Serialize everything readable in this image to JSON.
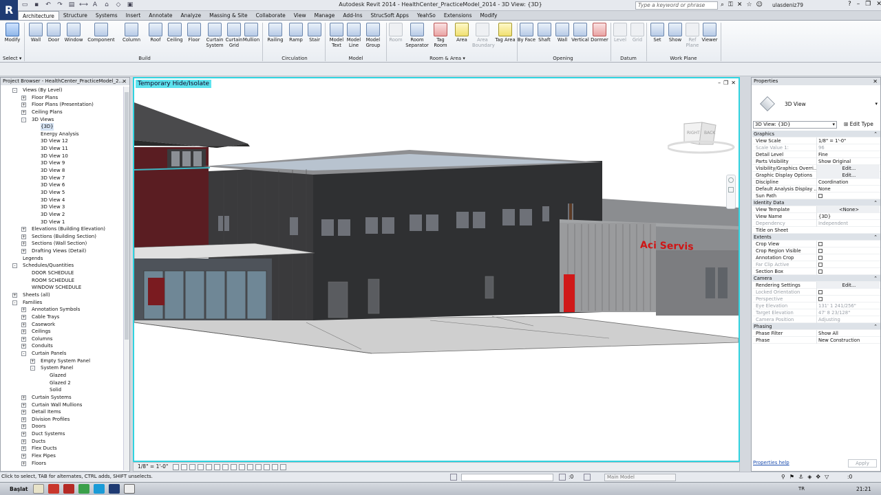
{
  "window": {
    "title": "Autodesk Revit 2014 -   HealthCenter_PracticeModel_2014 - 3D View: {3D}",
    "search_placeholder": "Type a keyword or phrase",
    "user": "ulasdeniz79",
    "app_letter": "R"
  },
  "ribbon": {
    "tabs": [
      "Architecture",
      "Structure",
      "Systems",
      "Insert",
      "Annotate",
      "Analyze",
      "Massing & Site",
      "Collaborate",
      "View",
      "Manage",
      "Add-Ins",
      "StrucSoft Apps",
      "YeahSo",
      "Extensions",
      "Modify"
    ],
    "buttons": {
      "modify": "Modify",
      "wall": "Wall",
      "door": "Door",
      "window": "Window",
      "component": "Component",
      "column": "Column",
      "roof": "Roof",
      "ceiling": "Ceiling",
      "floor": "Floor",
      "curtain_system": "Curtain System",
      "curtain_grid": "Curtain Grid",
      "mullion": "Mullion",
      "railing": "Railing",
      "ramp": "Ramp",
      "stair": "Stair",
      "model_text": "Model Text",
      "model_line": "Model Line",
      "model_group": "Model Group",
      "room": "Room",
      "room_separator": "Room Separator",
      "tag_room": "Tag Room",
      "area": "Area",
      "area_boundary": "Area Boundary",
      "tag_area": "Tag Area",
      "by_face": "By Face",
      "shaft": "Shaft",
      "wall_opening": "Wall",
      "vertical": "Vertical",
      "dormer": "Dormer",
      "level": "Level",
      "grid": "Grid",
      "set": "Set",
      "show": "Show",
      "ref_plane": "Ref Plane",
      "viewer": "Viewer"
    },
    "panels": {
      "build": "Build",
      "circulation": "Circulation",
      "model": "Model",
      "room_area": "Room & Area",
      "opening": "Opening",
      "datum": "Datum",
      "work_plane": "Work Plane"
    },
    "select_label": "Select"
  },
  "project_browser": {
    "title": "Project Browser - HealthCenter_PracticeModel_2...",
    "tree": [
      {
        "label": "Views (By Level)",
        "indent": 0,
        "tog": "-"
      },
      {
        "label": "Floor Plans",
        "indent": 1,
        "tog": "+"
      },
      {
        "label": "Floor Plans (Presentation)",
        "indent": 1,
        "tog": "+"
      },
      {
        "label": "Ceiling Plans",
        "indent": 1,
        "tog": "+"
      },
      {
        "label": "3D Views",
        "indent": 1,
        "tog": "-"
      },
      {
        "label": "{3D}",
        "indent": 2,
        "tog": "",
        "selected": true
      },
      {
        "label": "Energy Analysis",
        "indent": 2,
        "tog": ""
      },
      {
        "label": "3D View 12",
        "indent": 2,
        "tog": ""
      },
      {
        "label": "3D View 11",
        "indent": 2,
        "tog": ""
      },
      {
        "label": "3D View 10",
        "indent": 2,
        "tog": ""
      },
      {
        "label": "3D View 9",
        "indent": 2,
        "tog": ""
      },
      {
        "label": "3D View 8",
        "indent": 2,
        "tog": ""
      },
      {
        "label": "3D View 7",
        "indent": 2,
        "tog": ""
      },
      {
        "label": "3D View 6",
        "indent": 2,
        "tog": ""
      },
      {
        "label": "3D View 5",
        "indent": 2,
        "tog": ""
      },
      {
        "label": "3D View 4",
        "indent": 2,
        "tog": ""
      },
      {
        "label": "3D View 3",
        "indent": 2,
        "tog": ""
      },
      {
        "label": "3D View 2",
        "indent": 2,
        "tog": ""
      },
      {
        "label": "3D View 1",
        "indent": 2,
        "tog": ""
      },
      {
        "label": "Elevations (Building Elevation)",
        "indent": 1,
        "tog": "+"
      },
      {
        "label": "Sections (Building Section)",
        "indent": 1,
        "tog": "+"
      },
      {
        "label": "Sections (Wall Section)",
        "indent": 1,
        "tog": "+"
      },
      {
        "label": "Drafting Views (Detail)",
        "indent": 1,
        "tog": "+"
      },
      {
        "label": "Legends",
        "indent": 0,
        "tog": ""
      },
      {
        "label": "Schedules/Quantities",
        "indent": 0,
        "tog": "-"
      },
      {
        "label": "DOOR SCHEDULE",
        "indent": 1,
        "tog": ""
      },
      {
        "label": "ROOM SCHEDULE",
        "indent": 1,
        "tog": ""
      },
      {
        "label": "WINDOW SCHEDULE",
        "indent": 1,
        "tog": ""
      },
      {
        "label": "Sheets (all)",
        "indent": 0,
        "tog": "+"
      },
      {
        "label": "Families",
        "indent": 0,
        "tog": "-"
      },
      {
        "label": "Annotation Symbols",
        "indent": 1,
        "tog": "+"
      },
      {
        "label": "Cable Trays",
        "indent": 1,
        "tog": "+"
      },
      {
        "label": "Casework",
        "indent": 1,
        "tog": "+"
      },
      {
        "label": "Ceilings",
        "indent": 1,
        "tog": "+"
      },
      {
        "label": "Columns",
        "indent": 1,
        "tog": "+"
      },
      {
        "label": "Conduits",
        "indent": 1,
        "tog": "+"
      },
      {
        "label": "Curtain Panels",
        "indent": 1,
        "tog": "-"
      },
      {
        "label": "Empty System Panel",
        "indent": 2,
        "tog": "+"
      },
      {
        "label": "System Panel",
        "indent": 2,
        "tog": "-"
      },
      {
        "label": "Glazed",
        "indent": 3,
        "tog": ""
      },
      {
        "label": "Glazed 2",
        "indent": 3,
        "tog": ""
      },
      {
        "label": "Solid",
        "indent": 3,
        "tog": ""
      },
      {
        "label": "Curtain Systems",
        "indent": 1,
        "tog": "+"
      },
      {
        "label": "Curtain Wall Mullions",
        "indent": 1,
        "tog": "+"
      },
      {
        "label": "Detail Items",
        "indent": 1,
        "tog": "+"
      },
      {
        "label": "Division Profiles",
        "indent": 1,
        "tog": "+"
      },
      {
        "label": "Doors",
        "indent": 1,
        "tog": "+"
      },
      {
        "label": "Duct Systems",
        "indent": 1,
        "tog": "+"
      },
      {
        "label": "Ducts",
        "indent": 1,
        "tog": "+"
      },
      {
        "label": "Flex Ducts",
        "indent": 1,
        "tog": "+"
      },
      {
        "label": "Flex Pipes",
        "indent": 1,
        "tog": "+"
      },
      {
        "label": "Floors",
        "indent": 1,
        "tog": "+"
      }
    ]
  },
  "viewport": {
    "banner": "Temporary Hide/Isolate",
    "viewcube_right": "RIGHT",
    "viewcube_back": "BACK",
    "sign_text": "Aci Servis",
    "scale": "1/8\" = 1'-0\""
  },
  "properties": {
    "title": "Properties",
    "type_name": "3D View",
    "instance_select": "3D View: {3D}",
    "edit_type": "Edit Type",
    "rows": [
      {
        "group": "Graphics"
      },
      {
        "name": "View Scale",
        "value": "1/8\" = 1'-0\""
      },
      {
        "name": "Scale Value    1:",
        "value": "96",
        "dim": true
      },
      {
        "name": "Detail Level",
        "value": "Fine"
      },
      {
        "name": "Parts Visibility",
        "value": "Show Original"
      },
      {
        "name": "Visibility/Graphics Overri...",
        "value": "Edit...",
        "btn": true
      },
      {
        "name": "Graphic Display Options",
        "value": "Edit...",
        "btn": true
      },
      {
        "name": "Discipline",
        "value": "Coordination"
      },
      {
        "name": "Default Analysis Display ...",
        "value": "None"
      },
      {
        "name": "Sun Path",
        "check": true
      },
      {
        "group": "Identity Data"
      },
      {
        "name": "View Template",
        "value": "<None>",
        "btn": true
      },
      {
        "name": "View Name",
        "value": "{3D}"
      },
      {
        "name": "Dependency",
        "value": "Independent",
        "dim": true
      },
      {
        "name": "Title on Sheet",
        "value": ""
      },
      {
        "group": "Extents"
      },
      {
        "name": "Crop View",
        "check": true
      },
      {
        "name": "Crop Region Visible",
        "check": true
      },
      {
        "name": "Annotation Crop",
        "check": true
      },
      {
        "name": "Far Clip Active",
        "check": true,
        "dim": true
      },
      {
        "name": "Section Box",
        "check": true
      },
      {
        "group": "Camera"
      },
      {
        "name": "Rendering Settings",
        "value": "Edit...",
        "btn": true
      },
      {
        "name": "Locked Orientation",
        "check": true,
        "dim": true
      },
      {
        "name": "Perspective",
        "check": true,
        "dim": true
      },
      {
        "name": "Eye Elevation",
        "value": "131' 1 241/256\"",
        "dim": true
      },
      {
        "name": "Target Elevation",
        "value": "47' 8 23/128\"",
        "dim": true
      },
      {
        "name": "Camera Position",
        "value": "Adjusting",
        "dim": true
      },
      {
        "group": "Phasing"
      },
      {
        "name": "Phase Filter",
        "value": "Show All"
      },
      {
        "name": "Phase",
        "value": "New Construction"
      }
    ],
    "help": "Properties help",
    "apply": "Apply"
  },
  "status": {
    "hint": "Click to select, TAB for alternates, CTRL adds, SHIFT unselects.",
    "count": ":0",
    "model": "Main Model",
    "filter": ":0"
  },
  "taskbar": {
    "start": "Başlat",
    "lang": "TR",
    "time": "21:21"
  }
}
